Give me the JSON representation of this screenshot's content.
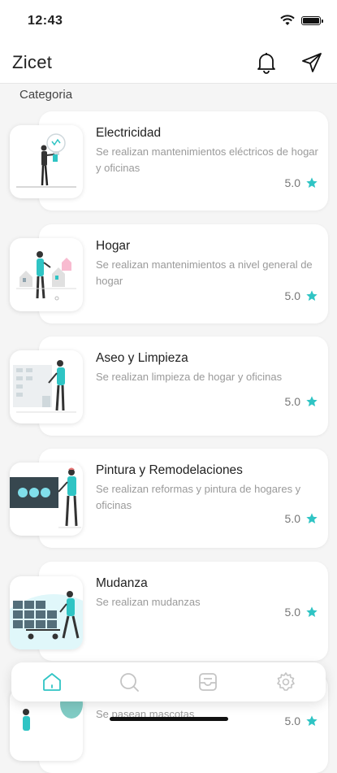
{
  "status_bar": {
    "time": "12:43"
  },
  "app": {
    "title": "Zicet",
    "section_label": "Categoria"
  },
  "categories": [
    {
      "name": "Electricidad",
      "description": "Se realizan mantenimientos eléctricos de hogar y oficinas",
      "rating": "5.0"
    },
    {
      "name": "Hogar",
      "description": "Se realizan mantenimientos a nivel general de hogar",
      "rating": "5.0"
    },
    {
      "name": "Aseo y Limpieza",
      "description": "Se realizan limpieza de hogar y oficinas",
      "rating": "5.0"
    },
    {
      "name": "Pintura y Remodelaciones",
      "description": "Se realizan reformas y pintura de hogares y oficinas",
      "rating": "5.0"
    },
    {
      "name": "Mudanza",
      "description": "Se realizan mudanzas",
      "rating": "5.0"
    },
    {
      "name": "",
      "description": "Se pasean mascotas",
      "rating": "5.0"
    }
  ],
  "icons": {
    "notifications": "bell-icon",
    "send": "send-icon",
    "home": "home-icon",
    "search": "search-icon",
    "inbox": "inbox-icon",
    "settings": "gear-icon"
  },
  "colors": {
    "accent": "#2fc4c4",
    "text": "#222222",
    "muted": "#9a9a9a"
  }
}
